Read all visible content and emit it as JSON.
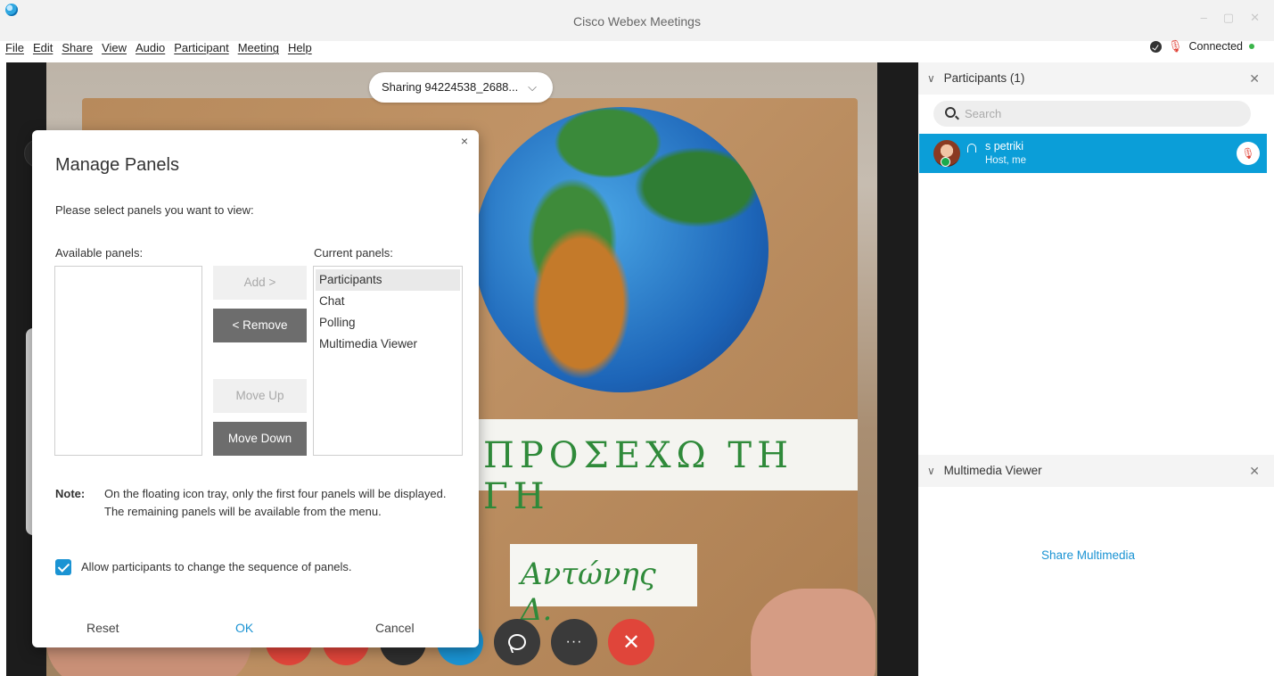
{
  "window": {
    "title": "Cisco Webex Meetings",
    "controls": [
      "–",
      "▢",
      "✕"
    ]
  },
  "menu": [
    "File",
    "Edit",
    "Share",
    "View",
    "Audio",
    "Participant",
    "Meeting",
    "Help"
  ],
  "status": {
    "connection": "Connected",
    "mic_icon": "mic-muted-icon"
  },
  "sharing": {
    "label": "Sharing 94224538_2688...",
    "chevron": "⌵"
  },
  "video_content": {
    "banner_text": "ΠΡΟΣΕΧΩ ΤΗ ΓΗ",
    "name_text": "Αντώνης Δ."
  },
  "controls": {
    "more": "···",
    "end": "✕"
  },
  "participants_panel": {
    "title": "Participants (1)",
    "search_placeholder": "Search",
    "participants": [
      {
        "name": "s petriki",
        "role": "Host, me",
        "mic": "muted"
      }
    ]
  },
  "multimedia_panel": {
    "title": "Multimedia Viewer",
    "action": "Share Multimedia"
  },
  "dialog": {
    "title": "Manage Panels",
    "subtitle": "Please select panels you want to view:",
    "available_label": "Available panels:",
    "current_label": "Current panels:",
    "available_panels": [],
    "current_panels": [
      "Participants",
      "Chat",
      "Polling",
      "Multimedia Viewer"
    ],
    "selected_index": 0,
    "buttons": {
      "add": "Add >",
      "remove": "< Remove",
      "move_up": "Move Up",
      "move_down": "Move Down"
    },
    "note_label": "Note:",
    "note_text": "On the floating icon tray, only the first four panels will be displayed. The remaining panels will be available from the menu.",
    "checkbox": {
      "label": "Allow participants to change the sequence of panels.",
      "checked": true
    },
    "footer": {
      "reset": "Reset",
      "ok": "OK",
      "cancel": "Cancel"
    },
    "close": "×"
  },
  "colors": {
    "accent": "#1a93d3",
    "participant_highlight": "#0b9ed8",
    "end_call": "#e0453a"
  }
}
